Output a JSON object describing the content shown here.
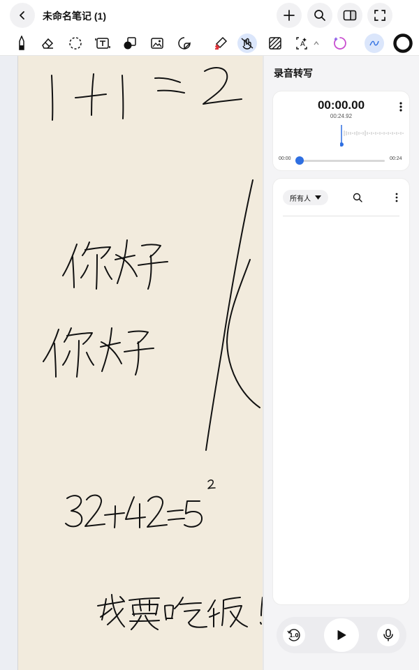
{
  "header": {
    "title": "未命名笔记 (1)",
    "icons": [
      "back-icon",
      "add-icon",
      "search-icon",
      "panel-toggle-icon",
      "expand-icon"
    ]
  },
  "toolbar": {
    "tools": [
      "pen-icon",
      "eraser-icon",
      "lasso-icon",
      "text-box-icon",
      "shape-icon",
      "image-icon",
      "sticker-icon",
      "highlighter-icon",
      "hand-draw-icon",
      "pattern-icon",
      "handwriting-convert-icon",
      "ai-icon",
      "stroke-style-icon",
      "color-black-icon"
    ],
    "active_tool": "hand-draw-icon",
    "accent_color": "#2f6fe1"
  },
  "canvas": {
    "background_color": "#f2ebdd",
    "handwriting": [
      "1+1=2",
      "你好",
      "你好",
      "32+42=5",
      "2",
      "我要吃饭!"
    ]
  },
  "panel": {
    "title": "录音转写",
    "recorder": {
      "current_time": "00:00.00",
      "total_time": "00:24.92",
      "start_label": "00:00",
      "end_label": "00:24",
      "progress": 0
    },
    "transcript": {
      "speaker_filter": "所有人"
    },
    "controls": {
      "speed_label": "1.0",
      "icons": [
        "speed-icon",
        "play-icon",
        "mic-icon"
      ]
    }
  }
}
